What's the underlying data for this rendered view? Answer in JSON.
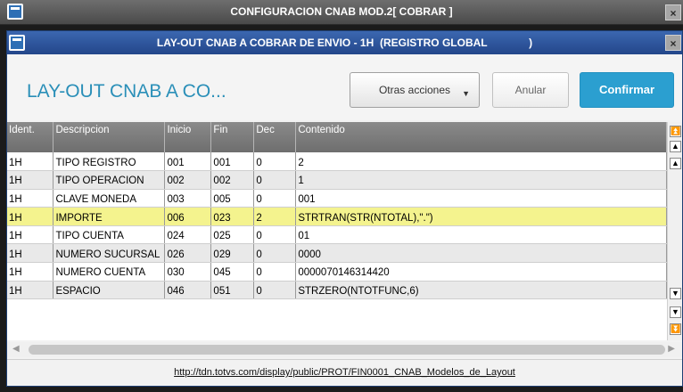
{
  "outer_window": {
    "title": "CONFIGURACION CNAB MOD.2[ COBRAR ]",
    "close": "×"
  },
  "inner_window": {
    "title": "LAY-OUT CNAB A COBRAR DE ENVIO - 1H  (REGISTRO GLOBAL              )",
    "close": "×"
  },
  "header": {
    "heading": "LAY-OUT CNAB A CO...",
    "otras_label": "Otras acciones",
    "anular_label": "Anular",
    "confirmar_label": "Confirmar"
  },
  "grid": {
    "columns": [
      "Ident.",
      "Descripcion",
      "Inicio",
      "Fin",
      "Dec",
      "Contenido"
    ],
    "rows": [
      [
        "1H",
        "TIPO REGISTRO",
        "001",
        "001",
        "0",
        "2"
      ],
      [
        "1H",
        "TIPO OPERACION",
        "002",
        "002",
        "0",
        "1"
      ],
      [
        "1H",
        "CLAVE MONEDA",
        "003",
        "005",
        "0",
        "001"
      ],
      [
        "1H",
        "IMPORTE",
        "006",
        "023",
        "2",
        "STRTRAN(STR(NTOTAL),\".\")"
      ],
      [
        "1H",
        "TIPO CUENTA",
        "024",
        "025",
        "0",
        "01"
      ],
      [
        "1H",
        "NUMERO SUCURSAL",
        "026",
        "029",
        "0",
        "0000"
      ],
      [
        "1H",
        "NUMERO CUENTA",
        "030",
        "045",
        "0",
        "0000070146314420"
      ],
      [
        "1H",
        "ESPACIO",
        "046",
        "051",
        "0",
        "STRZERO(NTOTFUNC,6)"
      ]
    ],
    "highlighted_row": 3
  },
  "colors": {
    "accent": "#2b9fd0",
    "heading": "#2a8fb8",
    "titlebar": "#23468a",
    "highlight": "#f4f38e"
  },
  "footer": {
    "link": "http://tdn.totvs.com/display/public/PROT/FIN0001_CNAB_Modelos_de_Layout"
  }
}
